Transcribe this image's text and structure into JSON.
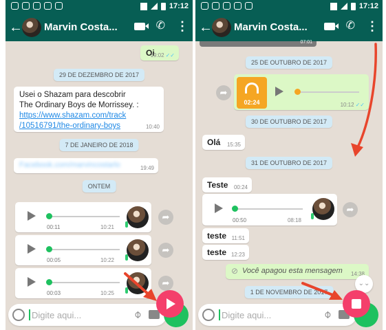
{
  "status_bar": {
    "time": "17:12"
  },
  "contact": {
    "name": "Marvin Costa..."
  },
  "left": {
    "msg_oi": {
      "text": "Oi",
      "time": "19:02"
    },
    "date1": "29 DE DEZEMBRO DE 2017",
    "shazam": {
      "line1": "Usei o Shazam para descobrir",
      "line2": "The Ordinary Boys de Morrissey. :",
      "link1": "https://www.shazam.com/track",
      "link2": "/10516791/the-ordinary-boys",
      "time": "10:40"
    },
    "date2": "7 DE JANEIRO DE 2018",
    "facebook": {
      "link": "Facebook.com/marvincostarlo",
      "time": "19:49"
    },
    "date3": "ONTEM",
    "voice": [
      {
        "duration": "00:11",
        "time": "10:21"
      },
      {
        "duration": "00:05",
        "time": "10:22"
      },
      {
        "duration": "00:03",
        "time": "10:25"
      }
    ],
    "input_placeholder": "Digite aqui..."
  },
  "right": {
    "strip_time": "07:01",
    "date1": "25 DE OUTUBRO DE 2017",
    "audio": {
      "duration": "02:24",
      "time": "10:12"
    },
    "date2": "30 DE OUTUBRO DE 2017",
    "msg_ola": {
      "text": "Olá",
      "time": "15:35"
    },
    "date3": "31 DE OUTUBRO DE 2017",
    "msg_teste1": {
      "text": "Teste",
      "time": "00:24"
    },
    "voice": {
      "duration": "00:50",
      "time": "08:18"
    },
    "msg_teste2": {
      "text": "teste",
      "time": "11:51"
    },
    "msg_teste3": {
      "text": "teste",
      "time": "12:23"
    },
    "deleted": {
      "text": "Você apagou esta mensagem",
      "time": "14:38"
    },
    "date4": "1 DE NOVEMBRO DE 2017",
    "input_placeholder": "Digite aqui..."
  },
  "colors": {
    "header": "#075e54",
    "accent_green": "#1ec15f",
    "record_button": "#f43f6b",
    "arrow": "#e8452c"
  }
}
